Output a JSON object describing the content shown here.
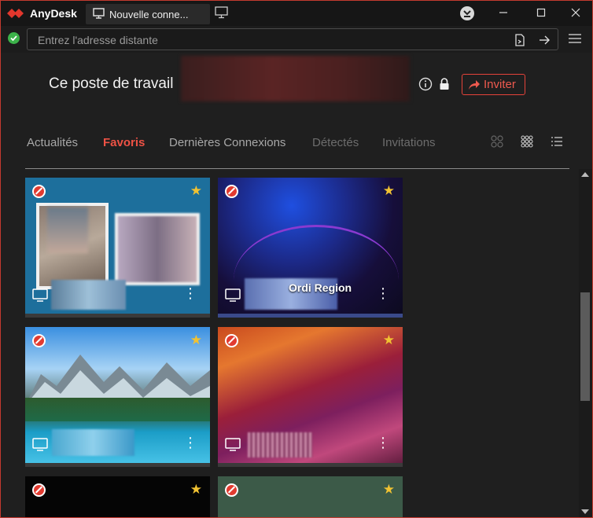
{
  "app": {
    "name": "AnyDesk",
    "tab_label": "Nouvelle conne..."
  },
  "address": {
    "placeholder": "Entrez l'adresse distante"
  },
  "this_desk": {
    "label": "Ce poste de travail",
    "invite_label": "Inviter"
  },
  "tabs": [
    {
      "label": "Actualités",
      "state": "normal"
    },
    {
      "label": "Favoris",
      "state": "active"
    },
    {
      "label": "Dernières Connexions",
      "state": "normal"
    },
    {
      "label": "Détectés",
      "state": "disabled"
    },
    {
      "label": "Invitations",
      "state": "disabled"
    }
  ],
  "cards": [
    {
      "alias": "",
      "starred": true,
      "blocked": true
    },
    {
      "alias": "Ordi Region",
      "starred": true,
      "blocked": true
    },
    {
      "alias": "",
      "starred": true,
      "blocked": true
    },
    {
      "alias": "",
      "starred": true,
      "blocked": true
    },
    {
      "alias": "",
      "starred": true,
      "blocked": true
    },
    {
      "alias": "",
      "starred": true,
      "blocked": true
    }
  ],
  "icons": {
    "logo": "anydesk-logo-icon",
    "monitor": "monitor-icon",
    "download": "download-icon",
    "status": "check-circle-icon",
    "file_transfer": "file-transfer-icon",
    "connect": "arrow-right-icon",
    "menu": "hamburger-menu-icon",
    "info": "info-icon",
    "lock": "lock-icon",
    "share": "share-arrow-icon",
    "star": "star-icon",
    "blocked": "blocked-icon",
    "more": "more-vertical-icon"
  },
  "colors": {
    "accent": "#ef5a4f",
    "star": "#f1c232",
    "ok": "#3cb24a",
    "window_border": "#c43a2f"
  }
}
